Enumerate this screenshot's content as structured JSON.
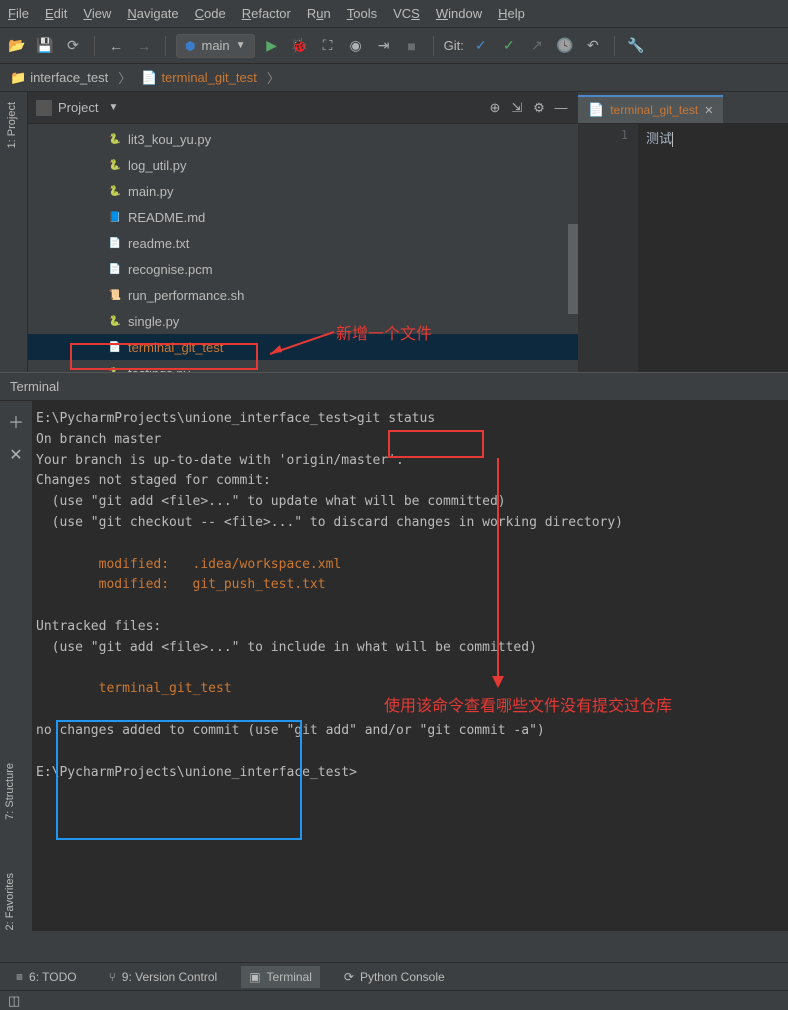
{
  "menubar": {
    "items": [
      "File",
      "Edit",
      "View",
      "Navigate",
      "Code",
      "Refactor",
      "Run",
      "Tools",
      "VCS",
      "Window",
      "Help"
    ]
  },
  "toolbar": {
    "run_config": "main",
    "git_label": "Git:"
  },
  "breadcrumb": {
    "project": "interface_test",
    "file": "terminal_git_test"
  },
  "project_panel": {
    "title": "Project",
    "files": [
      {
        "name": "lit3_kou_yu.py",
        "type": "py"
      },
      {
        "name": "log_util.py",
        "type": "py"
      },
      {
        "name": "main.py",
        "type": "py"
      },
      {
        "name": "README.md",
        "type": "md"
      },
      {
        "name": "readme.txt",
        "type": "txt"
      },
      {
        "name": "recognise.pcm",
        "type": "file"
      },
      {
        "name": "run_performance.sh",
        "type": "sh"
      },
      {
        "name": "single.py",
        "type": "py"
      },
      {
        "name": "terminal_git_test",
        "type": "txt",
        "selected": true,
        "orange": true
      },
      {
        "name": "testings.py",
        "type": "py"
      }
    ]
  },
  "editor": {
    "tab_name": "terminal_git_test",
    "line_number": "1",
    "content": "测试"
  },
  "terminal": {
    "title": "Terminal",
    "lines": [
      {
        "text": "E:\\PycharmProjects\\unione_interface_test>git status"
      },
      {
        "text": "On branch master"
      },
      {
        "text": "Your branch is up-to-date with 'origin/master'."
      },
      {
        "text": "Changes not staged for commit:"
      },
      {
        "text": "  (use \"git add <file>...\" to update what will be committed)"
      },
      {
        "text": "  (use \"git checkout -- <file>...\" to discard changes in working directory)"
      },
      {
        "text": ""
      },
      {
        "text": "        modified:   .idea/workspace.xml",
        "class": "modified"
      },
      {
        "text": "        modified:   git_push_test.txt",
        "class": "modified"
      },
      {
        "text": ""
      },
      {
        "text": "Untracked files:"
      },
      {
        "text": "  (use \"git add <file>...\" to include in what will be committed)"
      },
      {
        "text": ""
      },
      {
        "text": "        terminal_git_test",
        "class": "modified"
      },
      {
        "text": ""
      },
      {
        "text": "no changes added to commit (use \"git add\" and/or \"git commit -a\")"
      },
      {
        "text": ""
      },
      {
        "text": "E:\\PycharmProjects\\unione_interface_test>"
      }
    ]
  },
  "bottom_bar": {
    "items": [
      {
        "label": "6: TODO",
        "icon": "≡"
      },
      {
        "label": "9: Version Control",
        "icon": "⑂"
      },
      {
        "label": "Terminal",
        "icon": "▣",
        "active": true
      },
      {
        "label": "Python Console",
        "icon": "⟳"
      }
    ]
  },
  "left_vertical": {
    "project": "1: Project",
    "structure": "7: Structure",
    "favorites": "2: Favorites"
  },
  "annotations": {
    "new_file": "新增一个文件",
    "command_usage": "使用该命令查看哪些文件没有提交过仓库"
  }
}
